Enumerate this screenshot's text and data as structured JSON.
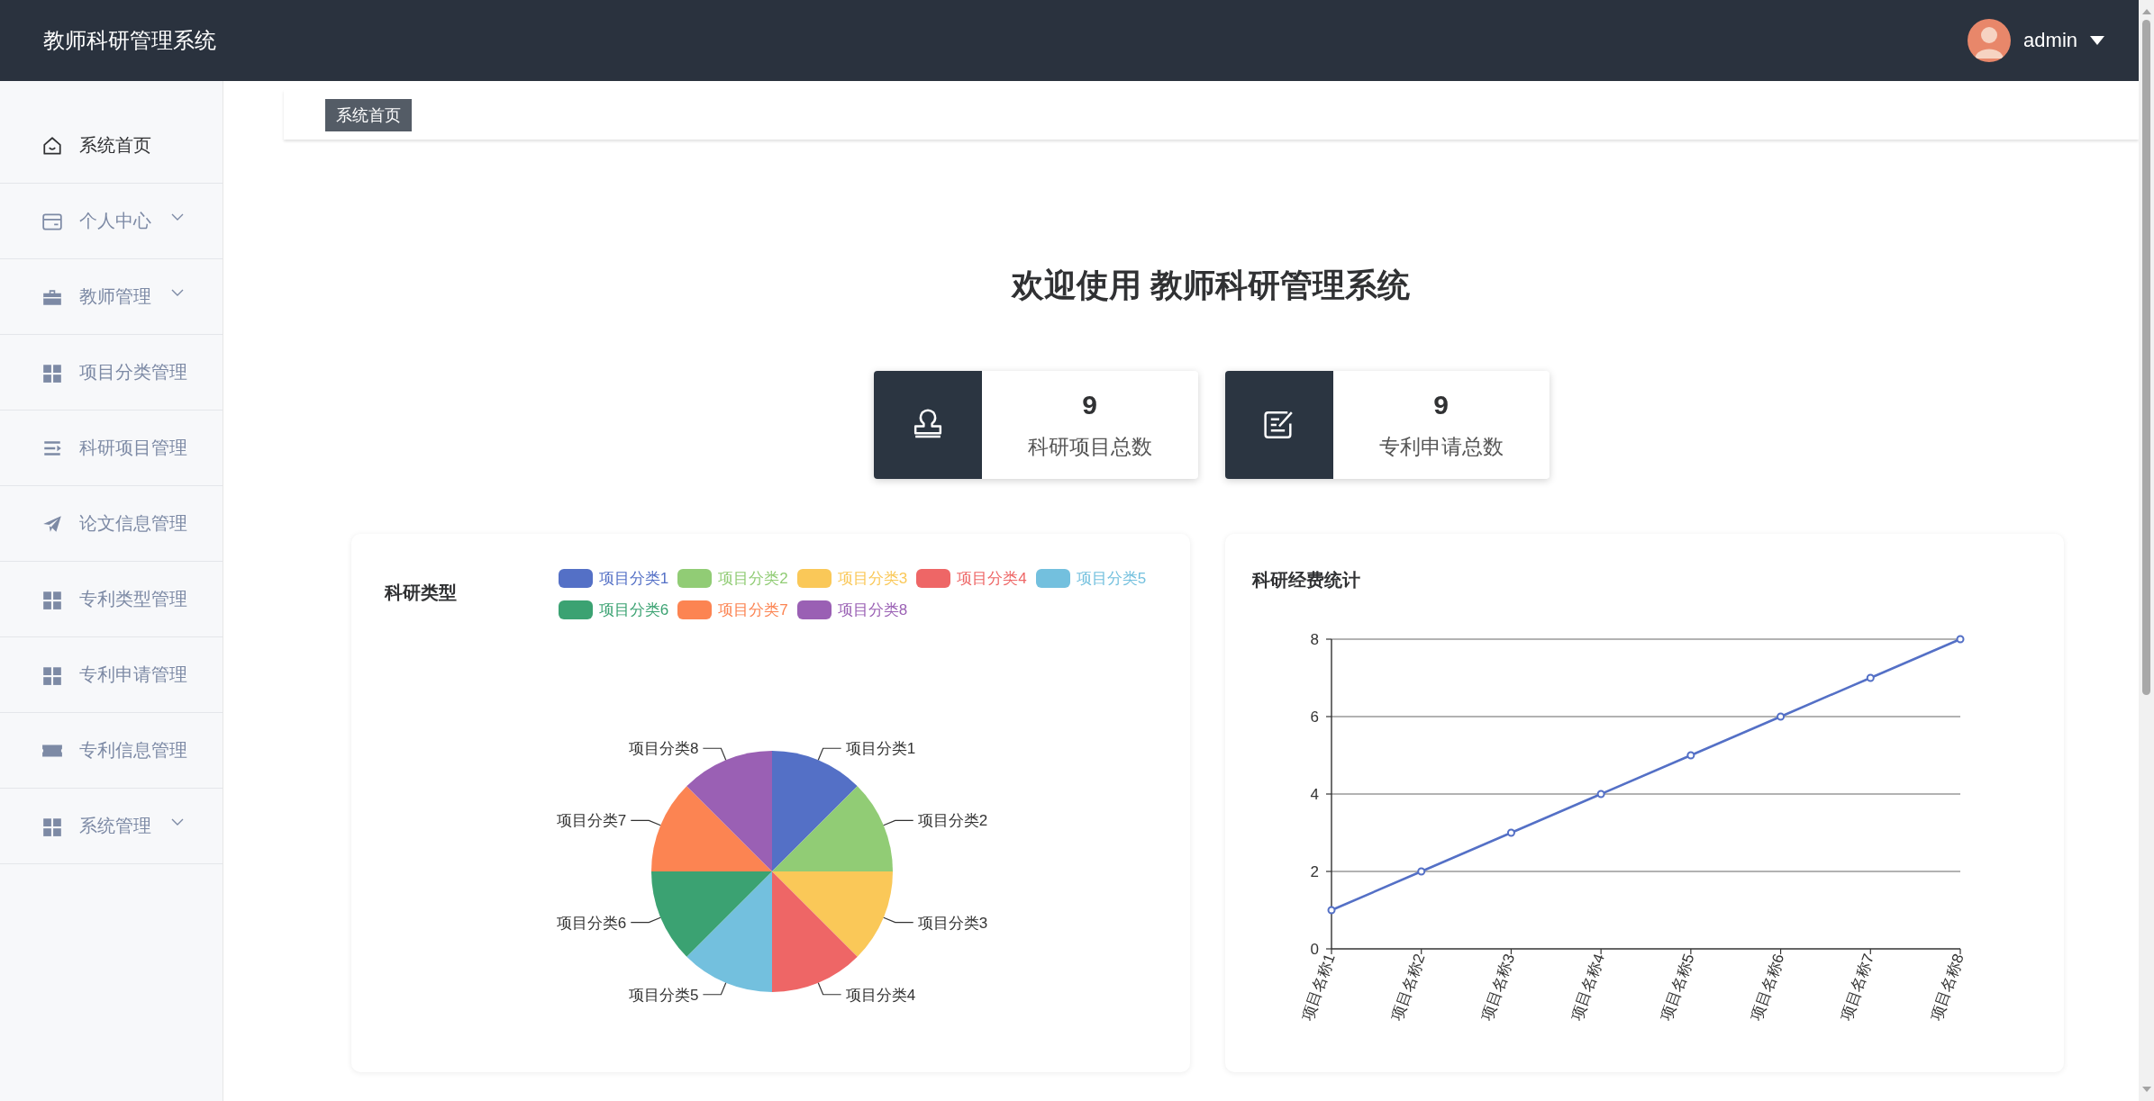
{
  "header": {
    "title": "教师科研管理系统",
    "user": "admin"
  },
  "sidebar": {
    "items": [
      {
        "label": "系统首页",
        "selected": true,
        "has_submenu": false
      },
      {
        "label": "个人中心",
        "selected": false,
        "has_submenu": true
      },
      {
        "label": "教师管理",
        "selected": false,
        "has_submenu": true
      },
      {
        "label": "项目分类管理",
        "selected": false,
        "has_submenu": false
      },
      {
        "label": "科研项目管理",
        "selected": false,
        "has_submenu": false
      },
      {
        "label": "论文信息管理",
        "selected": false,
        "has_submenu": false
      },
      {
        "label": "专利类型管理",
        "selected": false,
        "has_submenu": false
      },
      {
        "label": "专利申请管理",
        "selected": false,
        "has_submenu": false
      },
      {
        "label": "专利信息管理",
        "selected": false,
        "has_submenu": false
      },
      {
        "label": "系统管理",
        "selected": false,
        "has_submenu": true
      }
    ]
  },
  "breadcrumb": {
    "label": "系统首页"
  },
  "welcome": "欢迎使用 教师科研管理系统",
  "stats": [
    {
      "value": "9",
      "label": "科研项目总数"
    },
    {
      "value": "9",
      "label": "专利申请总数"
    }
  ],
  "charts": [
    {
      "chart_data": {
        "type": "pie",
        "title": "科研类型",
        "categories": [
          "项目分类1",
          "项目分类2",
          "项目分类3",
          "项目分类4",
          "项目分类5",
          "项目分类6",
          "项目分类7",
          "项目分类8"
        ],
        "values": [
          1,
          1,
          1,
          1,
          1,
          1,
          1,
          1
        ],
        "colors": [
          "#5470c6",
          "#91cc75",
          "#fac858",
          "#ee6666",
          "#73c0de",
          "#3ba272",
          "#fc8452",
          "#9a60b4"
        ],
        "data_labels": "category",
        "legend": "top"
      }
    },
    {
      "chart_data": {
        "type": "line",
        "title": "科研经费统计",
        "categories": [
          "项目名称1",
          "项目名称2",
          "项目名称3",
          "项目名称4",
          "项目名称5",
          "项目名称6",
          "项目名称7",
          "项目名称8"
        ],
        "series": [
          {
            "color": "#5470c6",
            "marker": "circle",
            "values": [
              1,
              2,
              3,
              4,
              5,
              6,
              7,
              8
            ]
          }
        ],
        "ylim": [
          0,
          8
        ],
        "yticks": [
          0,
          2,
          4,
          6,
          8
        ],
        "grid": true
      }
    }
  ]
}
